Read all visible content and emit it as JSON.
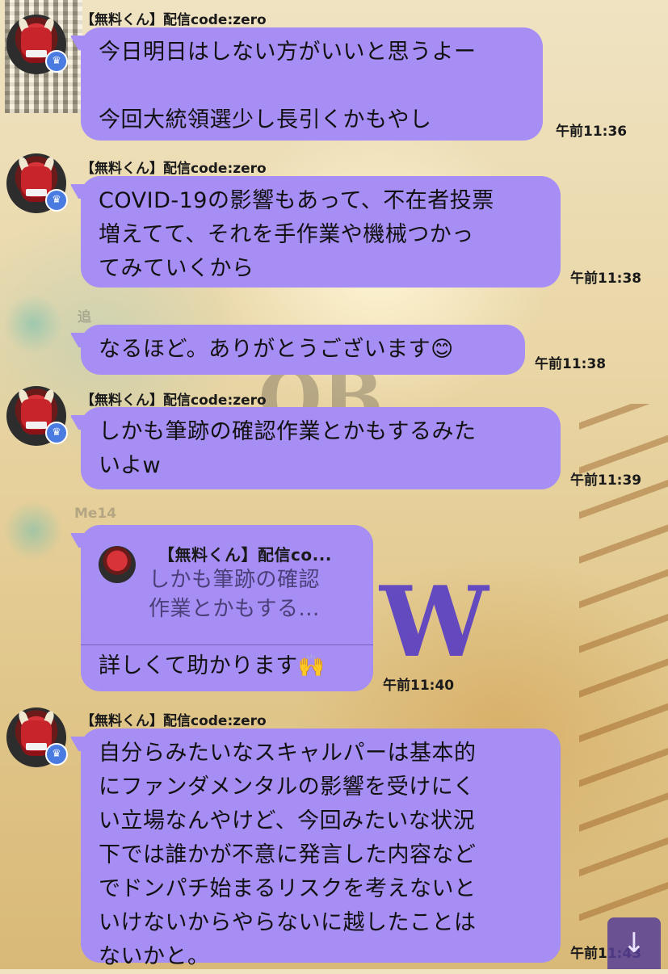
{
  "sender_name": "【無料くん】配信code:zero",
  "messages": [
    {
      "text": "今日明日はしない方がいいと思うよー\n\n今回大統領選少し長引くかもやし",
      "time": "午前11:36"
    },
    {
      "text": "COVID-19の影響もあって、不在者投票\n増えてて、それを手作業や機械つかっ\nてみていくから",
      "time": "午前11:38"
    },
    {
      "text": "なるほど。ありがとうございます😊",
      "time": "午前11:38"
    },
    {
      "text": "しかも筆跡の確認作業とかもするみた\nいよw",
      "time": "午前11:39"
    },
    {
      "text": "詳しくて助かります🙌",
      "time": "午前11:40",
      "reply": {
        "name": "【無料くん】配信co...",
        "text": "しかも筆跡の確認\n作業とかもする..."
      }
    },
    {
      "text": "自分らみたいなスキャルパーは基本的\nにファンダメンタルの影響を受けにく\nい立場なんやけど、今回みたいな状況\n下では誰かが不意に発言した内容など\nでドンパチ始まるリスクを考えないと\nいけないからやらないに越したことは\nないかと。",
      "time": "午前11:43"
    }
  ],
  "faded_names": [
    "追",
    "Me14"
  ],
  "icons": {
    "badge": "crown-icon",
    "scroll": "arrow-down-icon"
  },
  "colors": {
    "bubble": "#a68ef5",
    "badge": "#4a7be0"
  }
}
